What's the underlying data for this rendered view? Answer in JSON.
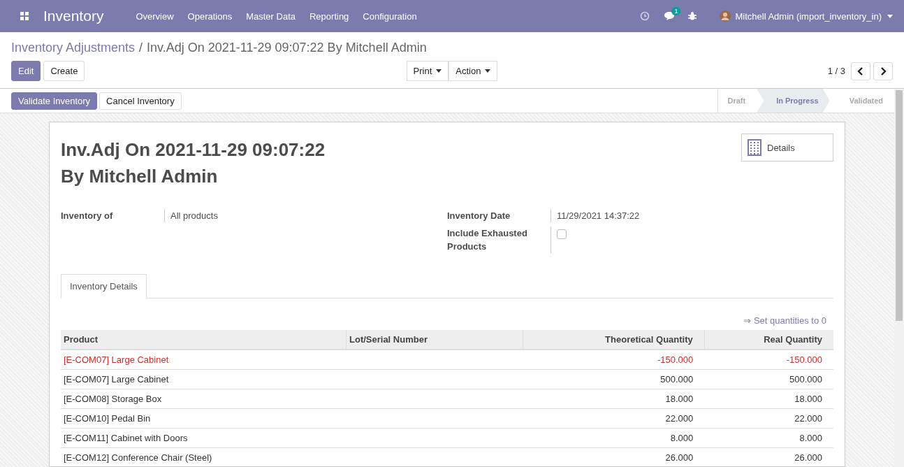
{
  "navbar": {
    "app_title": "Inventory",
    "menu": [
      "Overview",
      "Operations",
      "Master Data",
      "Reporting",
      "Configuration"
    ],
    "chat_badge": "1",
    "user": "Mitchell Admin (import_inventory_in)"
  },
  "breadcrumb": {
    "parent": "Inventory Adjustments",
    "separator": "/",
    "current": "Inv.Adj On 2021-11-29 09:07:22 By Mitchell Admin"
  },
  "buttons": [
    "Edit",
    "Create"
  ],
  "dropdowns": [
    "Print",
    "Action"
  ],
  "pager": "1 / 3",
  "header_buttons": [
    "Validate Inventory",
    "Cancel Inventory"
  ],
  "stages": [
    {
      "label": "Draft",
      "selected": false
    },
    {
      "label": "In Progress",
      "selected": true
    },
    {
      "label": "Validated",
      "selected": false
    }
  ],
  "sheet": {
    "title_line_1": "Inv.Adj On 2021-11-29 09:07:22",
    "title_line_2": "By Mitchell Admin",
    "smart_button": "Details",
    "fields_left": [
      {
        "label": "Inventory of",
        "value": "All products"
      }
    ],
    "date": {
      "label": "Inventory Date",
      "value": "11/29/2021 14:37:22"
    },
    "exhausted": {
      "label": "Include Exhausted Products",
      "checked": false
    },
    "tabs": [
      {
        "label": "Inventory Details",
        "selected": true
      }
    ],
    "set_link": "⇒ Set quantities to 0",
    "table": {
      "columns": [
        "Product",
        "Lot/Serial Number",
        "Theoretical Quantity",
        "Real Quantity"
      ],
      "rows": [
        {
          "product": "[E-COM07] Large Cabinet",
          "theoretical": "-150.000",
          "real": "-150.000",
          "kind": "negative"
        },
        {
          "product": "[E-COM07] Large Cabinet",
          "theoretical": "500.000",
          "real": "500.000",
          "kind": "normal"
        },
        {
          "product": "[E-COM08] Storage Box",
          "theoretical": "18.000",
          "real": "18.000",
          "kind": "normal"
        },
        {
          "product": "[E-COM10] Pedal Bin",
          "theoretical": "22.000",
          "real": "22.000",
          "kind": "normal"
        },
        {
          "product": "[E-COM11] Cabinet with Doors",
          "theoretical": "8.000",
          "real": "8.000",
          "kind": "normal"
        },
        {
          "product": "[E-COM12] Conference Chair (Steel)",
          "theoretical": "26.000",
          "real": "26.000",
          "kind": "normal"
        }
      ]
    }
  }
}
